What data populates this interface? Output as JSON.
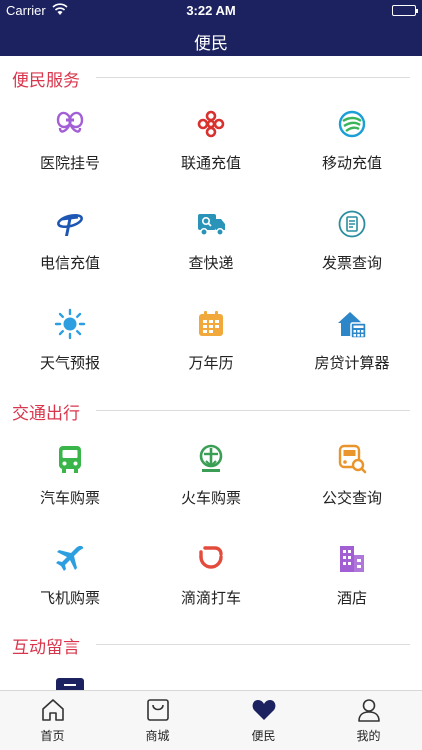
{
  "status_bar": {
    "carrier": "Carrier",
    "time": "3:22 AM"
  },
  "nav": {
    "title": "便民"
  },
  "sections": {
    "convenience": {
      "title": "便民服务",
      "items": [
        {
          "label": "医院挂号",
          "icon": "hospital-icon"
        },
        {
          "label": "联通充值",
          "icon": "unicom-icon"
        },
        {
          "label": "移动充值",
          "icon": "mobile-icon"
        },
        {
          "label": "电信充值",
          "icon": "telecom-icon"
        },
        {
          "label": "查快递",
          "icon": "delivery-truck-icon"
        },
        {
          "label": "发票查询",
          "icon": "invoice-icon"
        },
        {
          "label": "天气预报",
          "icon": "sun-icon"
        },
        {
          "label": "万年历",
          "icon": "calendar-icon"
        },
        {
          "label": "房贷计算器",
          "icon": "house-calculator-icon"
        }
      ]
    },
    "transport": {
      "title": "交通出行",
      "items": [
        {
          "label": "汽车购票",
          "icon": "bus-icon"
        },
        {
          "label": "火车购票",
          "icon": "train-icon"
        },
        {
          "label": "公交查询",
          "icon": "bus-search-icon"
        },
        {
          "label": "飞机购票",
          "icon": "airplane-icon"
        },
        {
          "label": "滴滴打车",
          "icon": "didi-icon"
        },
        {
          "label": "酒店",
          "icon": "hotel-icon"
        }
      ]
    },
    "interaction": {
      "title": "互动留言"
    }
  },
  "tabs": [
    {
      "label": "首页",
      "icon": "home-icon",
      "active": false
    },
    {
      "label": "商城",
      "icon": "shopping-bag-icon",
      "active": false
    },
    {
      "label": "便民",
      "icon": "heart-icon",
      "active": true
    },
    {
      "label": "我的",
      "icon": "person-icon",
      "active": false
    }
  ],
  "colors": {
    "nav_bg": "#1c2260",
    "section_title": "#d9364d",
    "tab_active": "#1c2260"
  }
}
